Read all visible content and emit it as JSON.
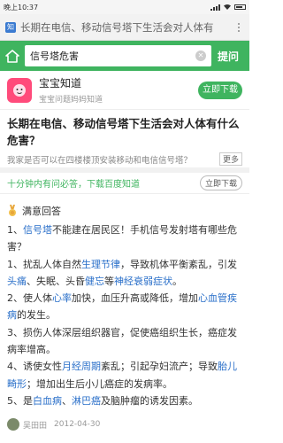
{
  "status_bar": {
    "time": "晚上10:37",
    "icons": [
      "signal-icon",
      "wifi-icon",
      "battery-icon"
    ]
  },
  "url_bar": {
    "text": "长期在电信、移动信号塔下生活会对人体有"
  },
  "search": {
    "query": "信号塔危害",
    "button_label": "提问"
  },
  "app_banner": {
    "name": "宝宝知道",
    "description": "宝宝问题妈妈知道",
    "button_label": "立即下载"
  },
  "question": {
    "title": "长期在电信、移动信号塔下生活会对人体有什么危害？",
    "description": "我家是否可以在四楼楼顶安装移动和电信信号塔？",
    "more_label": "更多"
  },
  "promo": {
    "text": "十分钟内有问必答，下载百度知道",
    "button_label": "立即下载"
  },
  "answer": {
    "label": "满意回答",
    "paragraphs": [
      [
        {
          "t": "1、",
          "link": false
        },
        {
          "t": "信号塔",
          "link": true
        },
        {
          "t": "不能建在居民区！手机信号发射塔有哪些危害？",
          "link": false
        }
      ],
      [
        {
          "t": "1、扰乱人体自然",
          "link": false
        },
        {
          "t": "生理节律",
          "link": true
        },
        {
          "t": "，导致机体平衡紊乱，引发",
          "link": false
        },
        {
          "t": "头痛",
          "link": true
        },
        {
          "t": "、失眠、头昏",
          "link": false
        },
        {
          "t": "健忘",
          "link": true
        },
        {
          "t": "等",
          "link": false
        },
        {
          "t": "神经衰弱症状",
          "link": true
        },
        {
          "t": "。",
          "link": false
        }
      ],
      [
        {
          "t": "2、使人体",
          "link": false
        },
        {
          "t": "心率",
          "link": true
        },
        {
          "t": "加快，血压升高或降低，增加",
          "link": false
        },
        {
          "t": "心血管疾病",
          "link": true
        },
        {
          "t": "的发生。",
          "link": false
        }
      ],
      [
        {
          "t": "3、损伤人体深层组织器官，促使癌组织生长，癌症发病率增高。",
          "link": false
        }
      ],
      [
        {
          "t": "4、诱使女性",
          "link": false
        },
        {
          "t": "月经周期",
          "link": true
        },
        {
          "t": "紊乱；引起孕妇流产；导致",
          "link": false
        },
        {
          "t": "胎儿畸形",
          "link": true
        },
        {
          "t": "；增加出生后小儿癌症的发病率。",
          "link": false
        }
      ],
      [
        {
          "t": "5、是",
          "link": false
        },
        {
          "t": "白血病",
          "link": true
        },
        {
          "t": "、",
          "link": false
        },
        {
          "t": "淋巴癌",
          "link": true
        },
        {
          "t": "及脑肿瘤的诱发因素。",
          "link": false
        }
      ]
    ]
  },
  "author": {
    "name": "吴田田",
    "date": "2012-04-30"
  },
  "colors": {
    "brand_green": "#3fb45f",
    "link_blue": "#2a6fc9",
    "app_pink": "#ff4b7b"
  }
}
